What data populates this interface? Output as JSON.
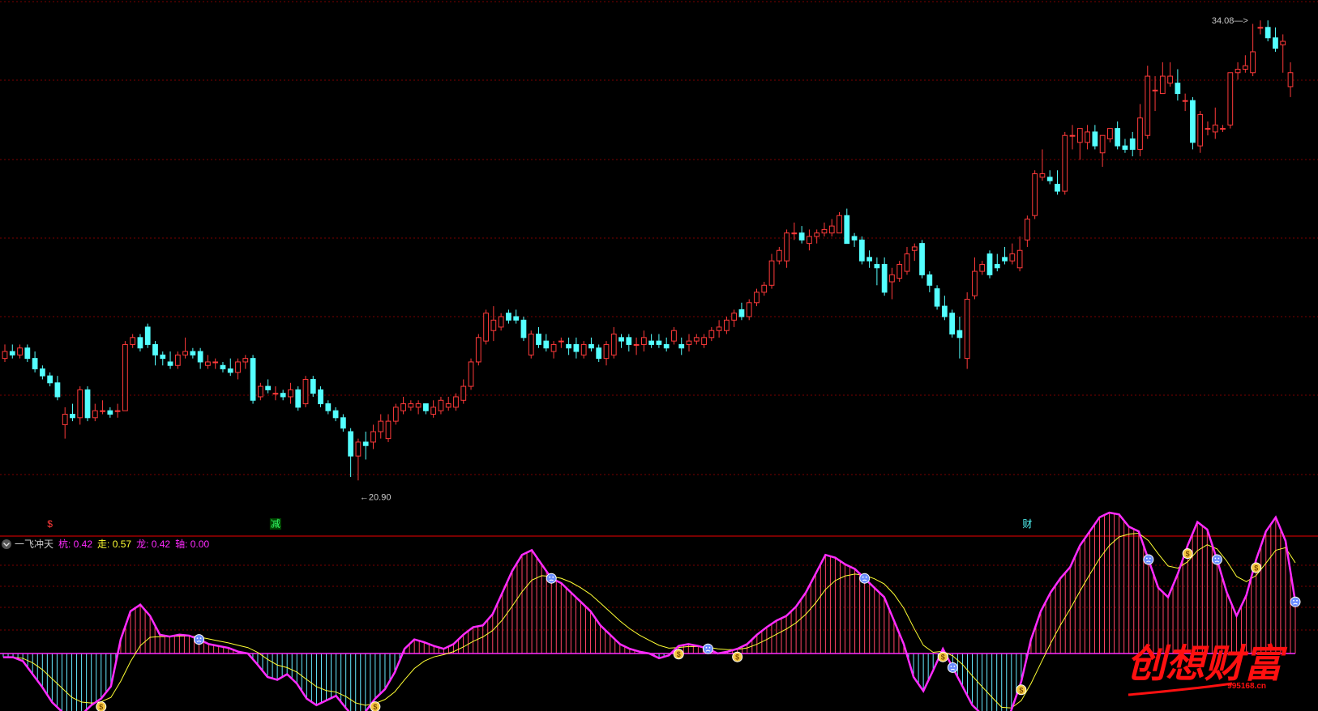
{
  "colors": {
    "up": "#ff3a3a",
    "down": "#54ffff",
    "grid": "#7a0000",
    "divider": "#a00000",
    "line_hang": "#ff2bff",
    "line_zou": "#ffff33",
    "hist_pos": "#ff4466",
    "hist_neg": "#66e8ff",
    "label_grey": "#c8c8c8",
    "watermark": "#ff1010"
  },
  "price_panel": {
    "high_marker": "34.08",
    "low_marker": "20.90",
    "markers": [
      {
        "text": "$",
        "index": 6,
        "color": "#ff3a3a"
      },
      {
        "text": "减",
        "index": 36,
        "color": "#33ff66"
      },
      {
        "text": "财",
        "index": 136,
        "color": "#54ffff"
      }
    ]
  },
  "indicator": {
    "name": "一飞冲天",
    "values": [
      {
        "label": "杭",
        "value": "0.42",
        "color": "#ff2bff"
      },
      {
        "label": "走",
        "value": "0.57",
        "color": "#ffff33"
      },
      {
        "label": "龙",
        "value": "0.42",
        "color": "#ff2bff"
      },
      {
        "label": "轴",
        "value": "0.00",
        "color": "#ff2bff"
      }
    ]
  },
  "watermark": {
    "text": "创想财富",
    "url": "995168.cn"
  },
  "chart_data": {
    "type": "candlestick",
    "ylim": [
      20.0,
      34.5
    ],
    "ohlc": [
      [
        24.4,
        24.8,
        24.3,
        24.6
      ],
      [
        24.6,
        24.8,
        24.4,
        24.5
      ],
      [
        24.5,
        24.8,
        24.4,
        24.7
      ],
      [
        24.7,
        24.8,
        24.3,
        24.4
      ],
      [
        24.4,
        24.6,
        24.0,
        24.1
      ],
      [
        24.1,
        24.2,
        23.8,
        23.9
      ],
      [
        23.9,
        24.0,
        23.6,
        23.7
      ],
      [
        23.7,
        23.9,
        23.2,
        23.3
      ],
      [
        22.5,
        23.0,
        22.1,
        22.8
      ],
      [
        22.8,
        23.1,
        22.6,
        22.7
      ],
      [
        22.7,
        23.6,
        22.5,
        23.5
      ],
      [
        23.5,
        23.6,
        22.6,
        22.7
      ],
      [
        22.7,
        23.1,
        22.6,
        22.9
      ],
      [
        22.9,
        23.2,
        22.8,
        22.9
      ],
      [
        22.9,
        23.0,
        22.7,
        22.8
      ],
      [
        22.9,
        23.1,
        22.7,
        22.9
      ],
      [
        22.9,
        24.9,
        22.9,
        24.8
      ],
      [
        24.8,
        25.1,
        24.7,
        25.0
      ],
      [
        25.0,
        25.1,
        24.6,
        24.7
      ],
      [
        25.3,
        25.4,
        24.7,
        24.8
      ],
      [
        24.8,
        24.9,
        24.2,
        24.5
      ],
      [
        24.5,
        24.6,
        24.2,
        24.4
      ],
      [
        24.3,
        24.6,
        24.1,
        24.2
      ],
      [
        24.2,
        24.6,
        24.1,
        24.5
      ],
      [
        24.5,
        25.0,
        24.4,
        24.6
      ],
      [
        24.6,
        24.7,
        24.4,
        24.5
      ],
      [
        24.6,
        24.7,
        24.1,
        24.3
      ],
      [
        24.2,
        24.5,
        24.1,
        24.3
      ],
      [
        24.3,
        24.4,
        24.1,
        24.3
      ],
      [
        24.2,
        24.3,
        24.0,
        24.1
      ],
      [
        24.1,
        24.4,
        23.9,
        24.0
      ],
      [
        24.0,
        24.4,
        23.8,
        24.3
      ],
      [
        24.3,
        24.5,
        24.1,
        24.4
      ],
      [
        24.4,
        24.5,
        23.1,
        23.2
      ],
      [
        23.3,
        23.7,
        23.2,
        23.6
      ],
      [
        23.6,
        23.8,
        23.4,
        23.5
      ],
      [
        23.4,
        23.6,
        23.2,
        23.4
      ],
      [
        23.4,
        23.5,
        23.2,
        23.3
      ],
      [
        23.3,
        23.7,
        23.1,
        23.5
      ],
      [
        23.5,
        23.6,
        22.9,
        23.0
      ],
      [
        23.1,
        23.9,
        23.0,
        23.8
      ],
      [
        23.8,
        23.9,
        23.3,
        23.4
      ],
      [
        23.5,
        23.6,
        23.0,
        23.1
      ],
      [
        23.1,
        23.2,
        22.8,
        22.9
      ],
      [
        22.9,
        23.0,
        22.6,
        22.7
      ],
      [
        22.7,
        22.8,
        22.3,
        22.4
      ],
      [
        22.3,
        22.4,
        21.0,
        21.6
      ],
      [
        21.6,
        22.1,
        20.9,
        22.0
      ],
      [
        22.0,
        22.3,
        21.5,
        21.9
      ],
      [
        22.0,
        22.5,
        21.8,
        22.3
      ],
      [
        22.3,
        22.8,
        22.1,
        22.6
      ],
      [
        22.1,
        22.8,
        22.0,
        22.6
      ],
      [
        22.6,
        23.1,
        22.5,
        23.0
      ],
      [
        22.9,
        23.3,
        22.8,
        23.1
      ],
      [
        23.0,
        23.2,
        22.9,
        23.1
      ],
      [
        23.0,
        23.2,
        22.8,
        23.1
      ],
      [
        23.1,
        23.1,
        22.8,
        22.9
      ],
      [
        22.8,
        23.2,
        22.7,
        23.0
      ],
      [
        22.9,
        23.3,
        22.8,
        23.2
      ],
      [
        23.0,
        23.3,
        22.9,
        23.1
      ],
      [
        23.0,
        23.4,
        22.9,
        23.3
      ],
      [
        23.2,
        23.8,
        23.1,
        23.6
      ],
      [
        23.6,
        24.4,
        23.5,
        24.3
      ],
      [
        24.3,
        25.1,
        24.2,
        25.0
      ],
      [
        24.9,
        25.8,
        24.8,
        25.7
      ],
      [
        25.2,
        25.9,
        24.9,
        25.5
      ],
      [
        25.3,
        25.7,
        25.2,
        25.6
      ],
      [
        25.7,
        25.8,
        25.4,
        25.5
      ],
      [
        25.6,
        25.8,
        25.4,
        25.5
      ],
      [
        25.5,
        25.6,
        24.9,
        25.0
      ],
      [
        24.5,
        25.2,
        24.4,
        25.1
      ],
      [
        25.1,
        25.3,
        24.7,
        24.8
      ],
      [
        24.9,
        25.1,
        24.6,
        24.7
      ],
      [
        24.6,
        24.9,
        24.4,
        24.8
      ],
      [
        24.9,
        25.0,
        24.7,
        24.9
      ],
      [
        24.8,
        25.0,
        24.5,
        24.7
      ],
      [
        24.8,
        25.0,
        24.4,
        24.6
      ],
      [
        24.5,
        24.9,
        24.4,
        24.8
      ],
      [
        24.8,
        25.0,
        24.6,
        24.7
      ],
      [
        24.7,
        24.8,
        24.3,
        24.4
      ],
      [
        24.4,
        24.9,
        24.2,
        24.8
      ],
      [
        24.5,
        25.3,
        24.4,
        25.1
      ],
      [
        25.0,
        25.1,
        24.7,
        24.9
      ],
      [
        25.0,
        25.1,
        24.6,
        24.8
      ],
      [
        24.8,
        25.0,
        24.5,
        24.8
      ],
      [
        24.8,
        25.2,
        24.6,
        25.0
      ],
      [
        24.9,
        25.1,
        24.7,
        24.8
      ],
      [
        24.9,
        25.1,
        24.7,
        24.8
      ],
      [
        24.8,
        25.0,
        24.6,
        24.7
      ],
      [
        24.9,
        25.3,
        24.8,
        25.2
      ],
      [
        24.8,
        25.0,
        24.5,
        24.7
      ],
      [
        24.8,
        25.1,
        24.6,
        24.9
      ],
      [
        24.9,
        25.1,
        24.8,
        25.0
      ],
      [
        24.8,
        25.1,
        24.7,
        25.0
      ],
      [
        25.0,
        25.3,
        24.9,
        25.2
      ],
      [
        25.2,
        25.5,
        25.0,
        25.3
      ],
      [
        25.2,
        25.6,
        25.1,
        25.5
      ],
      [
        25.5,
        25.8,
        25.3,
        25.7
      ],
      [
        25.8,
        26.0,
        25.5,
        25.6
      ],
      [
        25.6,
        26.1,
        25.5,
        26.0
      ],
      [
        26.0,
        26.4,
        25.9,
        26.3
      ],
      [
        26.3,
        26.6,
        26.2,
        26.5
      ],
      [
        26.5,
        27.4,
        26.4,
        27.2
      ],
      [
        27.2,
        27.6,
        27.1,
        27.5
      ],
      [
        27.2,
        28.1,
        27.0,
        28.0
      ],
      [
        28.0,
        28.3,
        27.8,
        28.0
      ],
      [
        28.0,
        28.2,
        27.7,
        27.8
      ],
      [
        27.7,
        28.1,
        27.5,
        27.9
      ],
      [
        27.9,
        28.1,
        27.7,
        28.0
      ],
      [
        28.0,
        28.3,
        27.9,
        28.1
      ],
      [
        28.0,
        28.4,
        27.9,
        28.2
      ],
      [
        28.0,
        28.6,
        28.0,
        28.5
      ],
      [
        28.5,
        28.7,
        27.7,
        27.7
      ],
      [
        27.9,
        28.0,
        27.6,
        27.8
      ],
      [
        27.8,
        27.9,
        27.1,
        27.2
      ],
      [
        27.3,
        27.5,
        27.0,
        27.2
      ],
      [
        27.1,
        27.3,
        26.5,
        27.0
      ],
      [
        27.1,
        27.3,
        26.2,
        26.3
      ],
      [
        26.6,
        27.0,
        26.1,
        26.8
      ],
      [
        26.7,
        27.2,
        26.6,
        27.1
      ],
      [
        26.9,
        27.6,
        26.8,
        27.4
      ],
      [
        27.5,
        27.7,
        27.2,
        27.6
      ],
      [
        27.7,
        27.8,
        26.7,
        26.8
      ],
      [
        26.8,
        26.9,
        26.3,
        26.5
      ],
      [
        26.4,
        26.5,
        25.8,
        25.9
      ],
      [
        25.9,
        26.2,
        25.5,
        25.6
      ],
      [
        25.7,
        25.8,
        25.0,
        25.1
      ],
      [
        25.2,
        25.6,
        24.4,
        25.0
      ],
      [
        24.4,
        26.3,
        24.1,
        26.1
      ],
      [
        26.2,
        27.3,
        26.1,
        26.9
      ],
      [
        26.9,
        27.2,
        26.8,
        27.1
      ],
      [
        27.4,
        27.5,
        26.7,
        26.8
      ],
      [
        27.1,
        27.4,
        26.9,
        27.0
      ],
      [
        27.3,
        27.6,
        27.1,
        27.2
      ],
      [
        27.2,
        27.7,
        27.1,
        27.4
      ],
      [
        27.0,
        27.9,
        26.9,
        27.5
      ],
      [
        27.8,
        28.5,
        27.6,
        28.4
      ],
      [
        28.5,
        29.8,
        28.4,
        29.7
      ],
      [
        29.6,
        30.4,
        29.5,
        29.7
      ],
      [
        29.6,
        29.8,
        29.4,
        29.5
      ],
      [
        29.4,
        29.8,
        29.1,
        29.2
      ],
      [
        29.2,
        30.9,
        29.1,
        30.8
      ],
      [
        30.8,
        31.1,
        30.4,
        30.8
      ],
      [
        30.6,
        31.0,
        30.1,
        31.0
      ],
      [
        30.6,
        31.1,
        30.4,
        30.9
      ],
      [
        30.9,
        31.1,
        30.4,
        30.5
      ],
      [
        30.3,
        30.8,
        29.9,
        30.8
      ],
      [
        30.7,
        31.0,
        30.6,
        31.0
      ],
      [
        31.0,
        31.2,
        30.4,
        30.5
      ],
      [
        30.5,
        30.7,
        30.3,
        30.4
      ],
      [
        30.7,
        30.9,
        30.2,
        30.4
      ],
      [
        30.4,
        31.7,
        30.2,
        31.3
      ],
      [
        30.8,
        32.8,
        30.7,
        32.5
      ],
      [
        32.1,
        32.5,
        31.5,
        32.1
      ],
      [
        32.0,
        32.9,
        32.0,
        32.5
      ],
      [
        32.3,
        32.9,
        32.2,
        32.5
      ],
      [
        32.3,
        32.7,
        31.8,
        32.0
      ],
      [
        31.8,
        32.0,
        31.5,
        31.8
      ],
      [
        31.8,
        31.9,
        30.4,
        30.6
      ],
      [
        30.5,
        31.5,
        30.3,
        31.4
      ],
      [
        31.0,
        31.2,
        30.8,
        31.0
      ],
      [
        30.9,
        31.6,
        30.7,
        31.1
      ],
      [
        31.0,
        31.1,
        30.9,
        31.0
      ],
      [
        31.1,
        32.6,
        31.0,
        32.6
      ],
      [
        32.6,
        32.9,
        32.4,
        32.7
      ],
      [
        32.7,
        33.1,
        32.6,
        32.8
      ],
      [
        32.6,
        34.0,
        32.5,
        33.2
      ],
      [
        33.9,
        34.1,
        33.7,
        33.9
      ],
      [
        33.9,
        34.1,
        33.5,
        33.6
      ],
      [
        33.6,
        33.9,
        33.2,
        33.3
      ],
      [
        33.4,
        33.7,
        32.6,
        33.5
      ],
      [
        32.2,
        32.9,
        31.9,
        32.6
      ]
    ],
    "osc": {
      "hang": [
        -0.04,
        -0.04,
        -0.08,
        -0.22,
        -0.36,
        -0.52,
        -0.62,
        -0.72,
        -0.65,
        -0.55,
        -0.48,
        -0.35,
        0.15,
        0.45,
        0.52,
        0.4,
        0.2,
        0.18,
        0.2,
        0.19,
        0.15,
        0.1,
        0.08,
        0.06,
        0.02,
        0.0,
        -0.12,
        -0.25,
        -0.28,
        -0.22,
        -0.32,
        -0.48,
        -0.55,
        -0.5,
        -0.45,
        -0.58,
        -0.7,
        -0.62,
        -0.48,
        -0.38,
        -0.2,
        0.05,
        0.15,
        0.12,
        0.08,
        0.05,
        0.1,
        0.2,
        0.28,
        0.3,
        0.42,
        0.65,
        0.88,
        1.05,
        1.1,
        0.95,
        0.8,
        0.75,
        0.65,
        0.55,
        0.45,
        0.3,
        0.2,
        0.1,
        0.05,
        0.02,
        0.0,
        -0.05,
        -0.02,
        0.08,
        0.1,
        0.08,
        0.05,
        0.0,
        0.02,
        0.05,
        0.1,
        0.2,
        0.28,
        0.35,
        0.4,
        0.5,
        0.65,
        0.85,
        1.05,
        1.02,
        0.95,
        0.9,
        0.8,
        0.7,
        0.6,
        0.35,
        0.1,
        -0.25,
        -0.4,
        -0.18,
        0.05,
        -0.15,
        -0.35,
        -0.55,
        -0.65,
        -0.75,
        -0.85,
        -0.6,
        -0.3,
        0.15,
        0.45,
        0.65,
        0.8,
        0.92,
        1.15,
        1.3,
        1.45,
        1.5,
        1.48,
        1.35,
        1.3,
        1.0,
        0.7,
        0.6,
        0.85,
        1.15,
        1.4,
        1.32,
        1.0,
        0.65,
        0.4,
        0.62,
        1.0,
        1.3,
        1.45,
        1.2,
        0.55
      ]
    }
  }
}
